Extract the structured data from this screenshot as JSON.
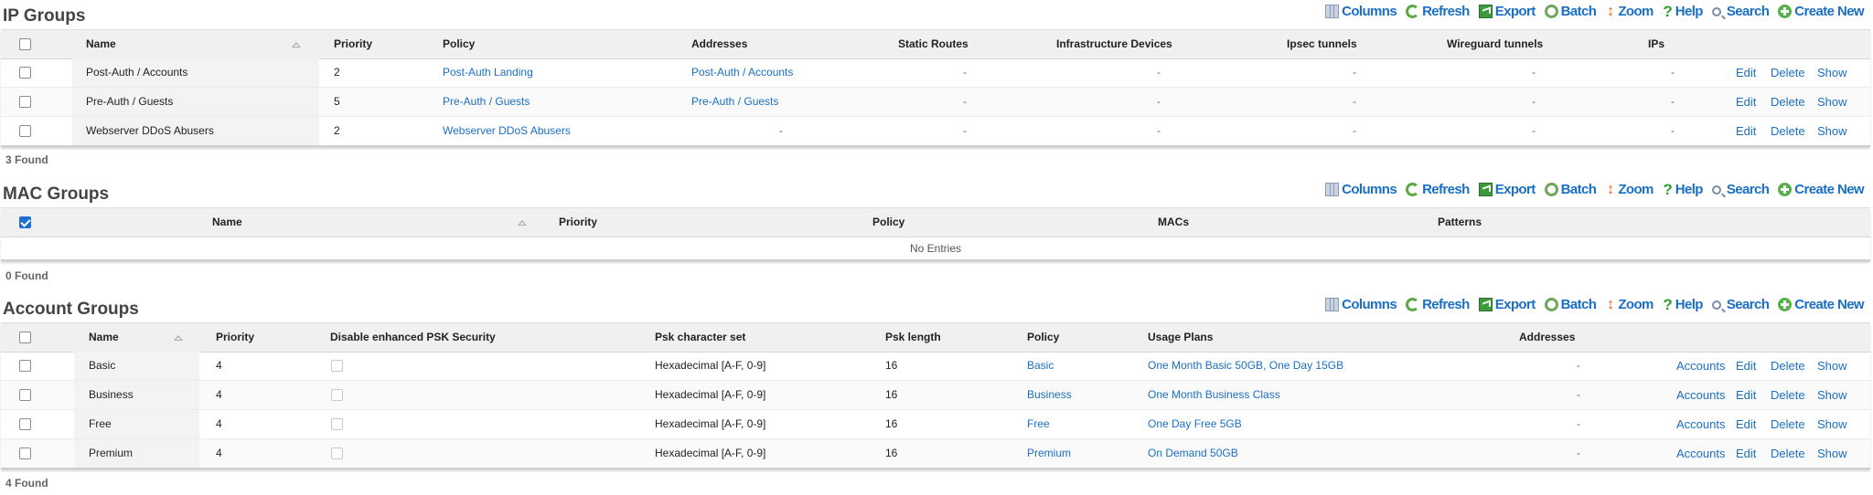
{
  "toolbar": {
    "columns": "Columns",
    "refresh": "Refresh",
    "export": "Export",
    "batch": "Batch",
    "zoom": "Zoom",
    "help": "Help",
    "search": "Search",
    "create_new": "Create New"
  },
  "ip_groups": {
    "title": "IP Groups",
    "headers": {
      "name": "Name",
      "priority": "Priority",
      "policy": "Policy",
      "addresses": "Addresses",
      "static_routes": "Static Routes",
      "infrastructure_devices": "Infrastructure Devices",
      "ipsec_tunnels": "Ipsec tunnels",
      "wireguard_tunnels": "Wireguard tunnels",
      "ips": "IPs"
    },
    "rows": [
      {
        "name": "Post-Auth / Accounts",
        "priority": "2",
        "policy": "Post-Auth Landing",
        "addresses": "Post-Auth / Accounts",
        "static_routes": "-",
        "infrastructure_devices": "-",
        "ipsec_tunnels": "-",
        "wireguard_tunnels": "-",
        "ips": "-"
      },
      {
        "name": "Pre-Auth / Guests",
        "priority": "5",
        "policy": "Pre-Auth / Guests",
        "addresses": "Pre-Auth / Guests",
        "static_routes": "-",
        "infrastructure_devices": "-",
        "ipsec_tunnels": "-",
        "wireguard_tunnels": "-",
        "ips": "-"
      },
      {
        "name": "Webserver DDoS Abusers",
        "priority": "2",
        "policy": "Webserver DDoS Abusers",
        "addresses": "-",
        "static_routes": "-",
        "infrastructure_devices": "-",
        "ipsec_tunnels": "-",
        "wireguard_tunnels": "-",
        "ips": "-"
      }
    ],
    "actions": {
      "edit": "Edit",
      "delete": "Delete",
      "show": "Show"
    },
    "found": "3 Found"
  },
  "mac_groups": {
    "title": "MAC Groups",
    "headers": {
      "name": "Name",
      "priority": "Priority",
      "policy": "Policy",
      "macs": "MACs",
      "patterns": "Patterns"
    },
    "no_entries": "No Entries",
    "found": "0 Found"
  },
  "account_groups": {
    "title": "Account Groups",
    "headers": {
      "name": "Name",
      "priority": "Priority",
      "disable_psk": "Disable enhanced PSK Security",
      "psk_charset": "Psk character set",
      "psk_length": "Psk length",
      "policy": "Policy",
      "usage_plans": "Usage Plans",
      "addresses": "Addresses"
    },
    "rows": [
      {
        "name": "Basic",
        "priority": "4",
        "psk_charset": "Hexadecimal [A-F, 0-9]",
        "psk_length": "16",
        "policy": "Basic",
        "usage_plans": "One Month Basic 50GB, One Day 15GB",
        "addresses": "-"
      },
      {
        "name": "Business",
        "priority": "4",
        "psk_charset": "Hexadecimal [A-F, 0-9]",
        "psk_length": "16",
        "policy": "Business",
        "usage_plans": "One Month Business Class",
        "addresses": "-"
      },
      {
        "name": "Free",
        "priority": "4",
        "psk_charset": "Hexadecimal [A-F, 0-9]",
        "psk_length": "16",
        "policy": "Free",
        "usage_plans": "One Day Free 5GB",
        "addresses": "-"
      },
      {
        "name": "Premium",
        "priority": "4",
        "psk_charset": "Hexadecimal [A-F, 0-9]",
        "psk_length": "16",
        "policy": "Premium",
        "usage_plans": "On Demand 50GB",
        "addresses": "-"
      }
    ],
    "actions": {
      "accounts": "Accounts",
      "edit": "Edit",
      "delete": "Delete",
      "show": "Show"
    },
    "found": "4 Found"
  },
  "colors": {
    "link": "#1a6fc4",
    "header_bg": "#f0f0f0",
    "checkbox_checked": "#1f6fd0"
  }
}
